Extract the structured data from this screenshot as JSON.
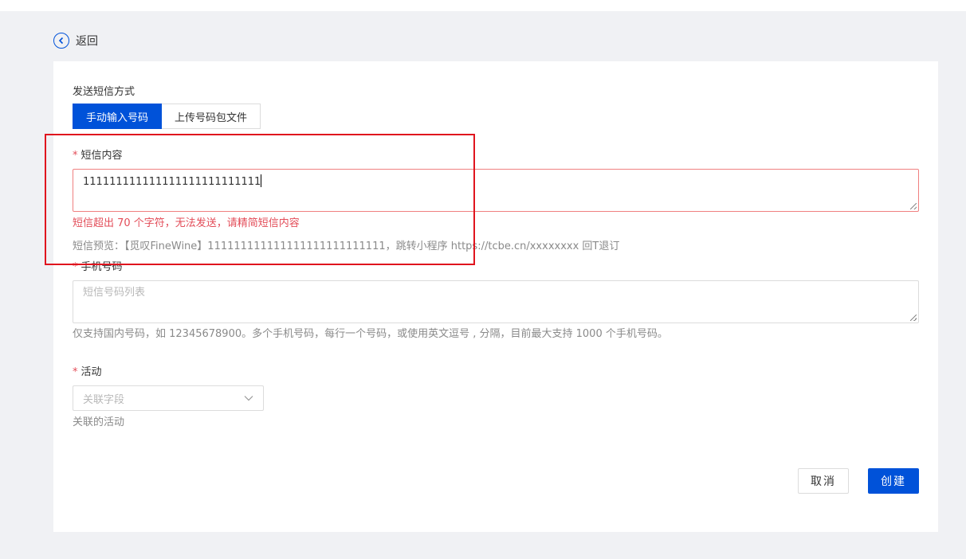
{
  "header": {
    "back_label": "返回"
  },
  "form": {
    "send_method": {
      "label": "发送短信方式",
      "options": [
        "手动输入号码",
        "上传号码包文件"
      ],
      "selected": "手动输入号码"
    },
    "sms_content": {
      "required_mark": "*",
      "label": "短信内容",
      "value": "111111111111111111111111111",
      "error": "短信超出 70 个字符，无法发送，请精简短信内容",
      "preview": "短信预览：【觅叹FineWine】111111111111111111111111111，跳转小程序 https://tcbe.cn/xxxxxxxx 回T退订"
    },
    "phone": {
      "required_mark": "*",
      "label": "手机号码",
      "placeholder": "短信号码列表",
      "hint": "仅支持国内号码，如 12345678900。多个手机号码，每行一个号码，或使用英文逗号 , 分隔，目前最大支持 1000 个手机号码。"
    },
    "activity": {
      "required_mark": "*",
      "label": "活动",
      "placeholder": "关联字段",
      "hint": "关联的活动"
    }
  },
  "actions": {
    "cancel_label": "取消",
    "create_label": "创建"
  },
  "colors": {
    "primary": "#0052d9",
    "error": "#e34d59",
    "highlight": "#e0141e"
  }
}
